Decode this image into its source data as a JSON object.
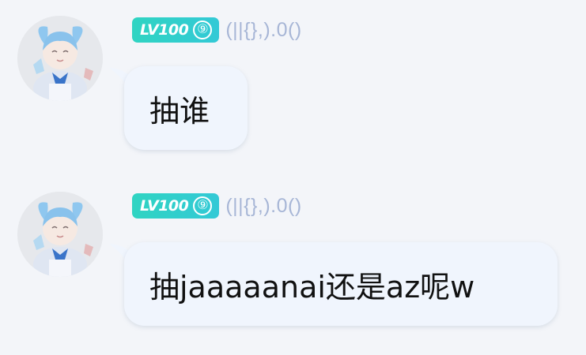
{
  "messages": [
    {
      "level_label": "LV100",
      "level_sub": "⑨",
      "nickname": "(||{},).0()",
      "text": "抽谁"
    },
    {
      "level_label": "LV100",
      "level_sub": "⑨",
      "nickname": "(||{},).0()",
      "text": "抽jaaaaanai还是az呢w"
    }
  ],
  "colors": {
    "background": "#f3f5f9",
    "bubble": "#f0f5fd",
    "level_badge": "#2fd4c2",
    "nickname": "#a7b6d6"
  }
}
